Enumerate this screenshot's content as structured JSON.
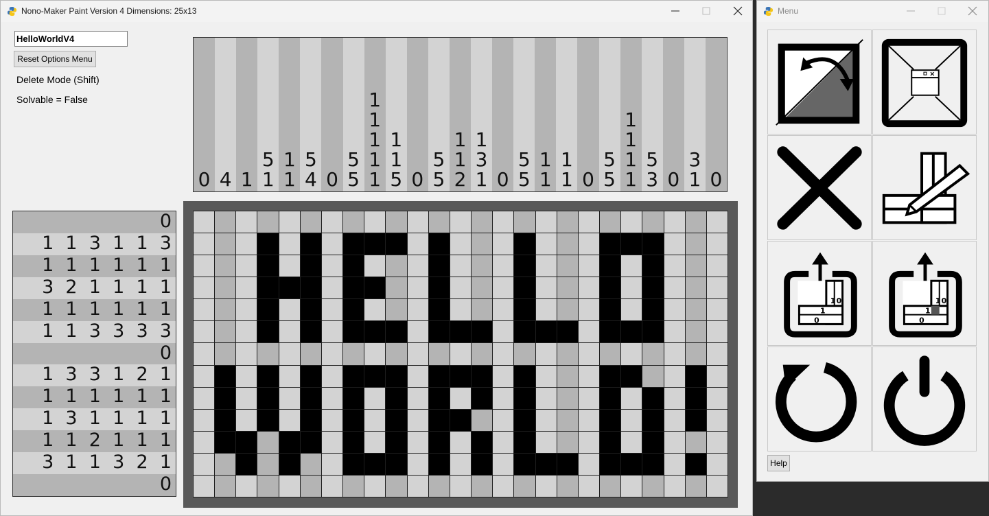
{
  "main_window": {
    "title": "Nono-Maker Paint Version 4 Dimensions: 25x13",
    "name_input_value": "HelloWorldV4",
    "reset_button_label": "Reset Options Menu",
    "delete_mode_label": "Delete Mode (Shift)",
    "solvable_label": "Solvable = False"
  },
  "menu_window": {
    "title": "Menu",
    "help_button_label": "Help",
    "buttons": [
      "swap-colors",
      "fit-to-window",
      "clear-canvas",
      "edit-dimensions",
      "export-puzzle",
      "export-solution",
      "restart",
      "power-off"
    ]
  },
  "puzzle": {
    "columns": 25,
    "rows": 13,
    "column_clues": [
      [
        "0"
      ],
      [
        "4"
      ],
      [
        "1"
      ],
      [
        "5",
        "1"
      ],
      [
        "1",
        "1"
      ],
      [
        "5",
        "4"
      ],
      [
        "0"
      ],
      [
        "5",
        "5"
      ],
      [
        "1",
        "1",
        "1",
        "1",
        "1"
      ],
      [
        "1",
        "1",
        "5"
      ],
      [
        "0"
      ],
      [
        "5",
        "5"
      ],
      [
        "1",
        "1",
        "2"
      ],
      [
        "1",
        "3",
        "1"
      ],
      [
        "0"
      ],
      [
        "5",
        "5"
      ],
      [
        "1",
        "1"
      ],
      [
        "1",
        "1"
      ],
      [
        "0"
      ],
      [
        "5",
        "5"
      ],
      [
        "1",
        "1",
        "1",
        "1"
      ],
      [
        "5",
        "3"
      ],
      [
        "0"
      ],
      [
        "3",
        "1"
      ],
      [
        "0"
      ]
    ],
    "row_clues": [
      "0",
      "1  1  3  1  1  3",
      "1  1  1  1  1  1",
      "3  2  1  1  1  1",
      "1  1  1  1  1  1",
      "1  1  3  3  3  3",
      "0",
      "1  3  3  1  2  1",
      "1  1  1  1  1  1",
      "1  3  1  1  1  1",
      "1  1  2  1  1  1",
      "3  1  1  3  2  1",
      "0"
    ],
    "grid": [
      "0000000000000000000000000",
      "0001010111010001000111000",
      "0001010100010001000101000",
      "0001110110010001000101000",
      "0001010100010001000101000",
      "0001010111011101110111000",
      "0000000000000000000000000",
      "0101010111011101000110010",
      "0101010101010101000101010",
      "0101010101011001000101010",
      "0110110101010101000101000",
      "0010100111010101110111010",
      "0000000000000000000000000"
    ]
  },
  "colors": {
    "filled": "#000000",
    "light_cell": "#d3d3d3",
    "dark_cell": "#b4b4b4",
    "frame": "#595959"
  }
}
